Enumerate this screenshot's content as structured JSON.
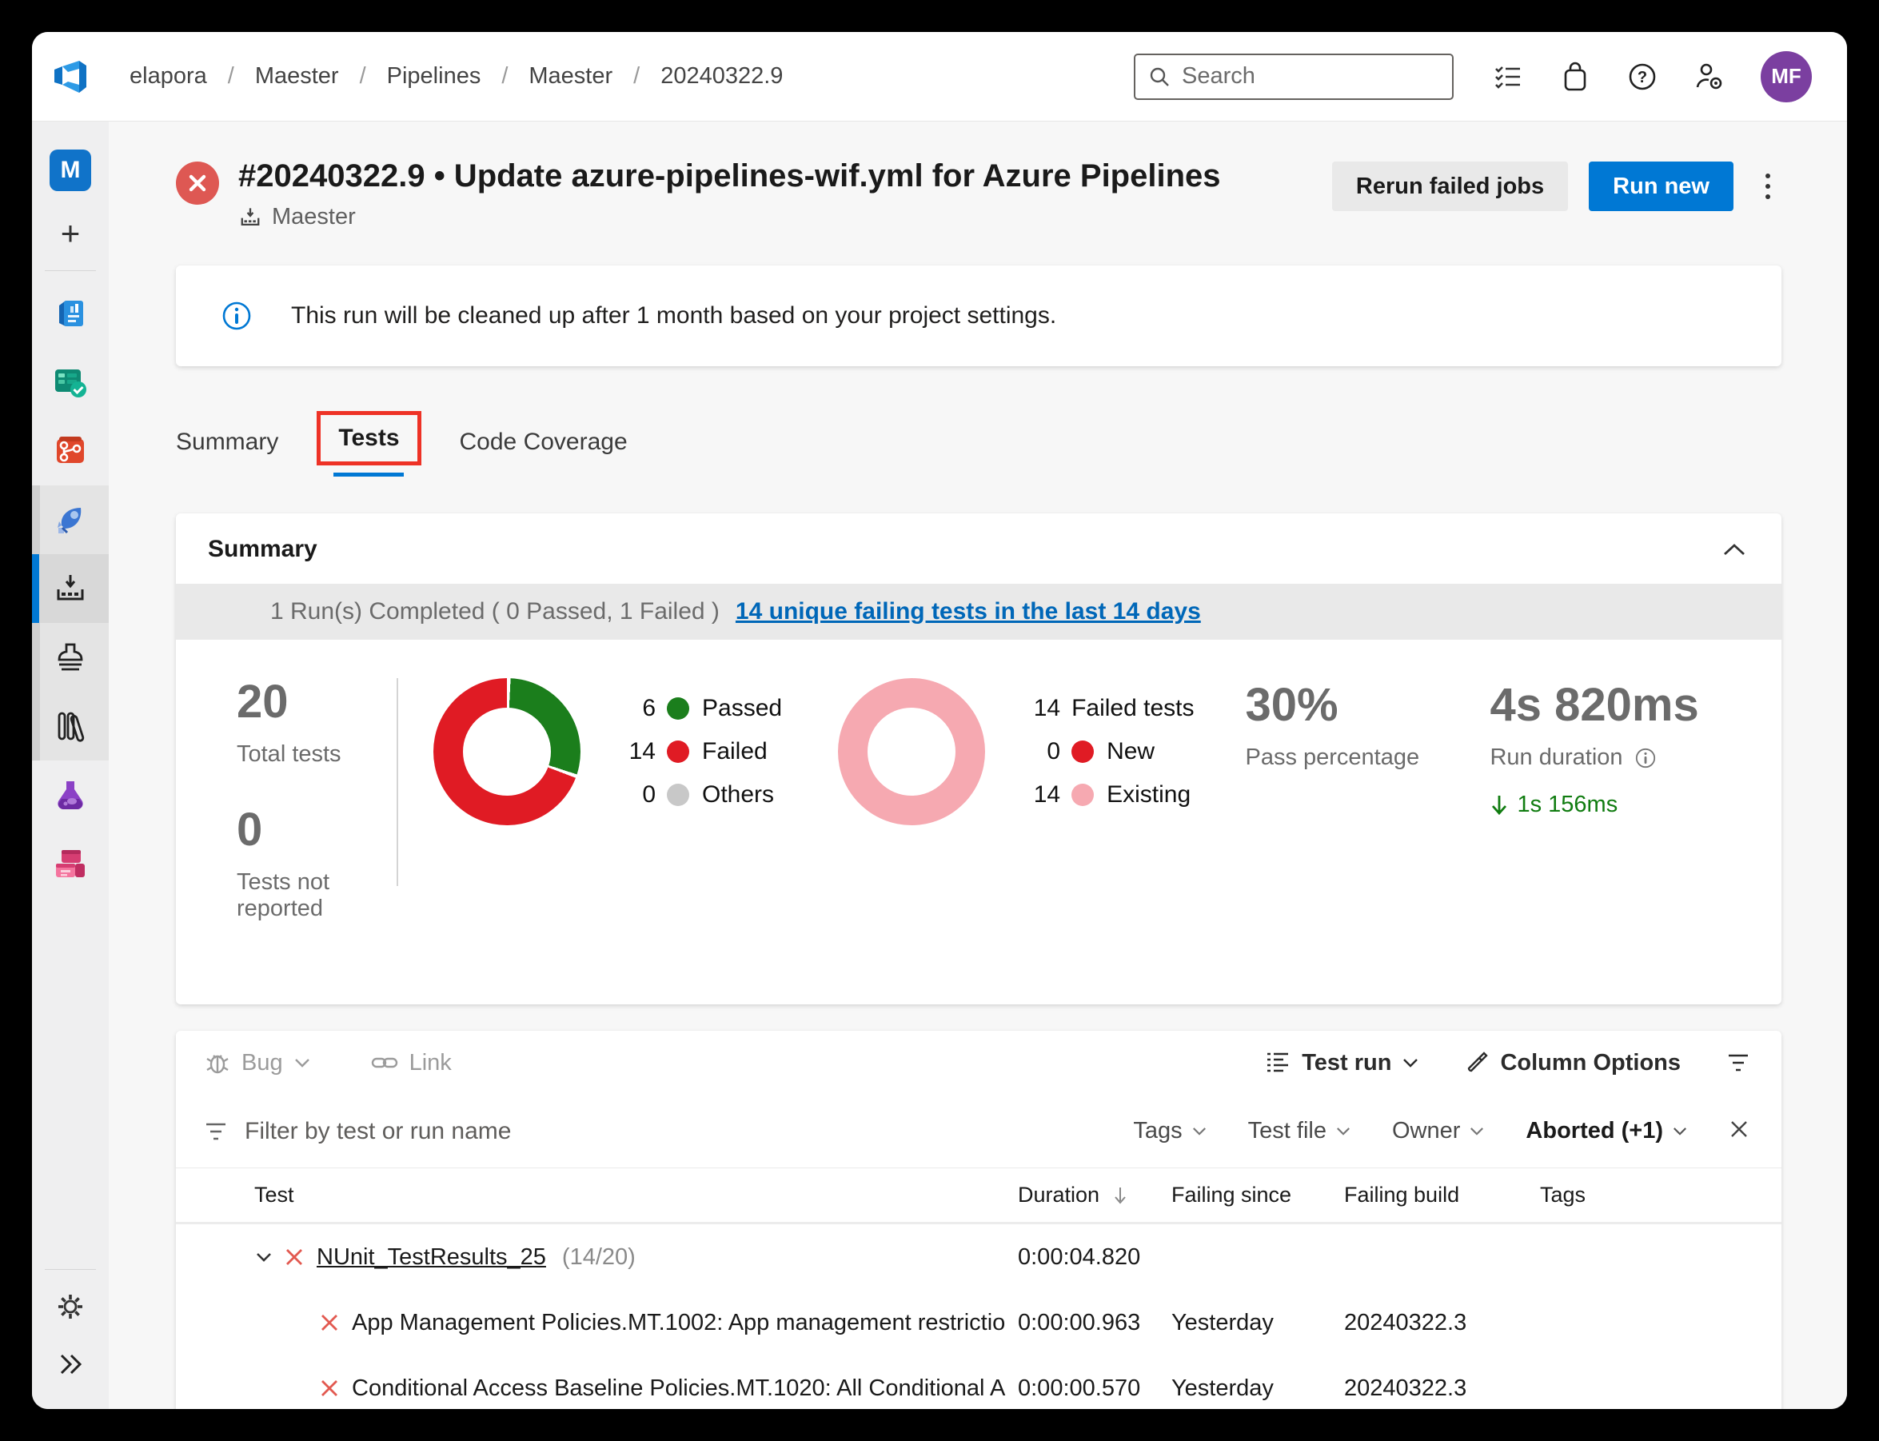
{
  "topbar": {
    "breadcrumbs": [
      "elapora",
      "Maester",
      "Pipelines",
      "Maester",
      "20240322.9"
    ],
    "search_placeholder": "Search",
    "avatar_initials": "MF",
    "icons": [
      "task-list-icon",
      "marketplace-bag-icon",
      "help-icon",
      "user-settings-icon"
    ]
  },
  "sidebar": {
    "project_initial": "M",
    "items": [
      {
        "name": "project-avatar",
        "icon": "m-tile"
      },
      {
        "name": "add-project",
        "icon": "plus-icon"
      },
      {
        "name": "overview",
        "icon": "overview-icon"
      },
      {
        "name": "boards",
        "icon": "boards-icon"
      },
      {
        "name": "repos",
        "icon": "repos-branch-icon"
      },
      {
        "name": "pipelines",
        "icon": "rocket-icon"
      },
      {
        "name": "releases",
        "icon": "deploy-tray-icon",
        "selected": true
      },
      {
        "name": "environments",
        "icon": "stamp-icon"
      },
      {
        "name": "library",
        "icon": "library-columns-icon"
      },
      {
        "name": "test-plans",
        "icon": "flask-icon"
      },
      {
        "name": "artifacts",
        "icon": "boxes-icon"
      },
      {
        "name": "settings",
        "icon": "gear-icon"
      },
      {
        "name": "collapse",
        "icon": "double-chevron-icon"
      }
    ]
  },
  "header": {
    "title": "#20240322.9 • Update azure-pipelines-wif.yml for Azure Pipelines",
    "pipeline_name": "Maester",
    "rerun_button": "Rerun failed jobs",
    "run_new_button": "Run new"
  },
  "banner": {
    "text": "This run will be cleaned up after 1 month based on your project settings."
  },
  "tabs": {
    "summary": "Summary",
    "tests": "Tests",
    "code_coverage": "Code Coverage"
  },
  "summary": {
    "title": "Summary",
    "runs_line": "1 Run(s) Completed ( 0 Passed, 1 Failed )",
    "failing_link": "14 unique failing tests in the last 14 days",
    "total_tests": "20",
    "total_tests_label": "Total tests",
    "not_reported": "0",
    "not_reported_label": "Tests not reported",
    "pass_pct": "30%",
    "pass_pct_label": "Pass percentage",
    "duration": "4s 820ms",
    "duration_label": "Run duration",
    "duration_delta": "1s 156ms"
  },
  "chart_data": [
    {
      "type": "pie",
      "title": "Test results",
      "labels": [
        "Passed",
        "Failed",
        "Others"
      ],
      "values": [
        6,
        14,
        0
      ],
      "colors": [
        "#1B7E1C",
        "#E01B24",
        "#C8C8C8"
      ],
      "total": 20,
      "legend_position": "right"
    },
    {
      "type": "pie",
      "title": "Failed tests",
      "total_label": "Failed tests",
      "total": 14,
      "labels": [
        "New",
        "Existing"
      ],
      "values": [
        0,
        14
      ],
      "colors": [
        "#E01B24",
        "#F6A9B1"
      ],
      "legend_position": "right"
    }
  ],
  "results": {
    "toolbar": {
      "bug": "Bug",
      "link": "Link",
      "test_run": "Test run",
      "column_options": "Column Options"
    },
    "filter": {
      "placeholder": "Filter by test or run name",
      "tags": "Tags",
      "test_file": "Test file",
      "owner": "Owner",
      "outcome": "Aborted (+1)"
    },
    "columns": {
      "test": "Test",
      "duration": "Duration",
      "failing_since": "Failing since",
      "failing_build": "Failing build",
      "tags": "Tags"
    },
    "rows": [
      {
        "name": "NUnit_TestResults_25",
        "count": "(14/20)",
        "duration": "0:00:04.820",
        "failing_since": "",
        "failing_build": ""
      },
      {
        "name": "App Management Policies.MT.1002: App management restrictio",
        "duration": "0:00:00.963",
        "failing_since": "Yesterday",
        "failing_build": "20240322.3"
      },
      {
        "name": "Conditional Access Baseline Policies.MT.1020: All Conditional A",
        "duration": "0:00:00.570",
        "failing_since": "Yesterday",
        "failing_build": "20240322.3"
      }
    ]
  },
  "colors": {
    "accent_blue": "#0078D4",
    "link_blue": "#0067B8",
    "fail_red": "#DE5853",
    "annotation_red": "#EE3226",
    "delta_green": "#107C10",
    "avatar_purple": "#7B3FA0"
  }
}
